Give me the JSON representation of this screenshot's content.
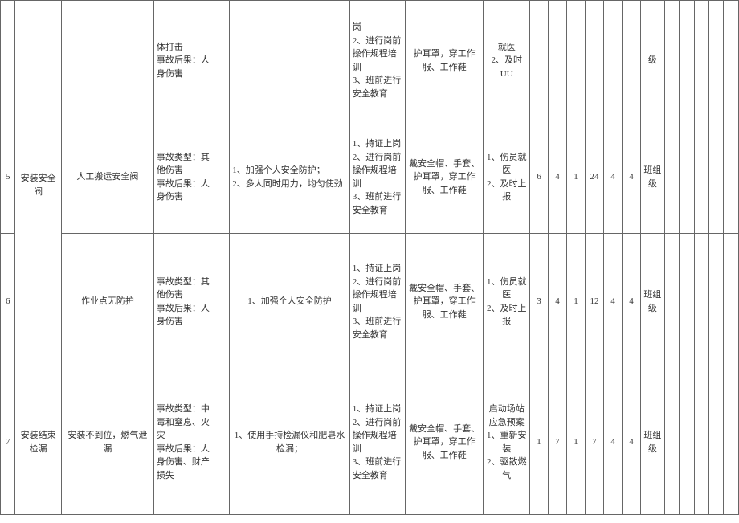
{
  "rows": [
    {
      "idx": "",
      "task": "",
      "activity": "",
      "accident": "体打击\n事故后果：人身伤害",
      "x": "",
      "engineering": "",
      "management": "岗\n2、进行岗前操作规程培训\n3、班前进行安全教育",
      "ppe": "护耳罩，穿工作服、工作鞋",
      "emergency": "就医\n2、及时\nUU",
      "n1": "",
      "n2": "",
      "n3": "",
      "n4": "",
      "n5": "",
      "n6": "",
      "lvl": "级",
      "e1": "",
      "e2": "",
      "e3": "",
      "e4": "",
      "e5": ""
    },
    {
      "idx": "5",
      "task": "",
      "activity": "人工搬运安全阀",
      "accident": "事故类型：其他伤害\n事故后果：人身伤害",
      "x": "",
      "engineering": "1、加强个人安全防护；\n2、多人同时用力，均匀使劲",
      "management": "1、持证上岗\n2、进行岗前操作规程培训\n3、班前进行安全教育",
      "ppe": "戴安全帽、手套、护耳罩，穿工作服、工作鞋",
      "emergency": "1、伤员就医\n2、及时上报",
      "n1": "6",
      "n2": "4",
      "n3": "1",
      "n4": "24",
      "n5": "4",
      "n6": "4",
      "lvl": "班组级",
      "e1": "",
      "e2": "",
      "e3": "",
      "e4": "",
      "e5": ""
    },
    {
      "idx": "6",
      "task": "安装安全阀",
      "activity": "作业点无防护",
      "accident": "事故类型：其他伤害\n事故后果：人身伤害",
      "x": "",
      "engineering": "1、加强个人安全防护",
      "management": "1、持证上岗\n2、进行岗前操作规程培训\n3、班前进行安全教育",
      "ppe": "戴安全帽、手套、护耳罩，穿工作服、工作鞋",
      "emergency": "1、伤员就医\n2、及时上报",
      "n1": "3",
      "n2": "4",
      "n3": "1",
      "n4": "12",
      "n5": "4",
      "n6": "4",
      "lvl": "班组级",
      "e1": "",
      "e2": "",
      "e3": "",
      "e4": "",
      "e5": ""
    },
    {
      "idx": "7",
      "task": "安装结束检漏",
      "activity": "安装不到位，燃气泄漏",
      "accident": "事故类型：中毒和窒息、火灾\n事故后果：人身伤害、财产损失",
      "x": "",
      "engineering": "1、使用手持检漏仪和肥皂水检漏；",
      "management": "1、持证上岗\n2、进行岗前操作规程培训\n3、班前进行安全教育",
      "ppe": "戴安全帽、手套、护耳罩，穿工作服、工作鞋",
      "emergency": "启动场站应急预案\n1、重新安装\n2、驱散燃气",
      "n1": "1",
      "n2": "7",
      "n3": "1",
      "n4": "7",
      "n5": "4",
      "n6": "4",
      "lvl": "班组级",
      "e1": "",
      "e2": "",
      "e3": "",
      "e4": "",
      "e5": ""
    }
  ]
}
